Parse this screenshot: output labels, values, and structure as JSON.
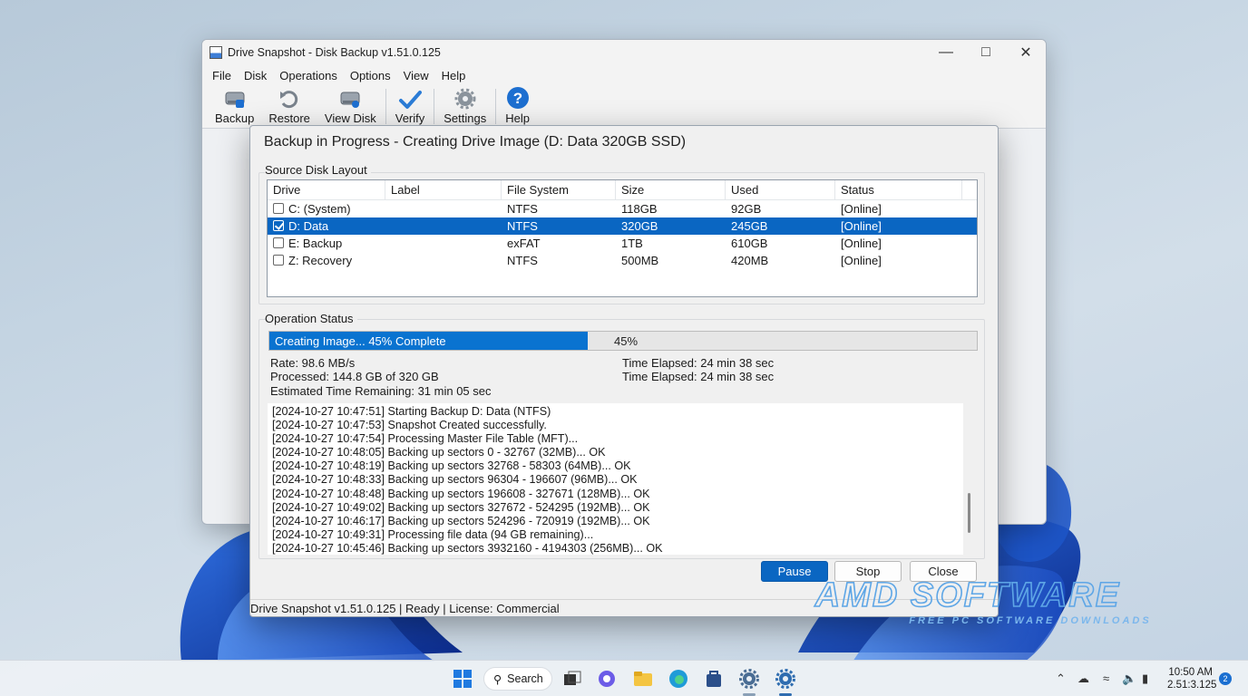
{
  "window": {
    "title": "Drive Snapshot - Disk Backup v1.51.0.125",
    "menu": [
      "File",
      "Disk",
      "Operations",
      "Options",
      "View",
      "Help"
    ],
    "toolbar": [
      {
        "label": "Backup",
        "icon": "backup-disk-icon"
      },
      {
        "label": "Restore",
        "icon": "restore-arrow-icon"
      },
      {
        "label": "View Disk",
        "icon": "view-disk-icon"
      },
      {
        "label": "Verify",
        "icon": "checkmark-icon"
      },
      {
        "label": "Settings",
        "icon": "gear-icon"
      },
      {
        "label": "Help",
        "icon": "help-question-icon"
      }
    ]
  },
  "dialog": {
    "title": "Backup in Progress - Creating Drive Image (D: Data 320GB SSD)",
    "source_group_label": "Source Disk Layout",
    "columns": [
      "Drive",
      "Label",
      "File System",
      "Size",
      "Used",
      "Status"
    ],
    "drives": [
      {
        "drive": "C: (System)",
        "label": "",
        "fs": "NTFS",
        "size": "118GB",
        "used": "92GB",
        "status": "[Online]",
        "checked": false
      },
      {
        "drive": "D: Data",
        "label": "",
        "fs": "NTFS",
        "size": "320GB",
        "used": "245GB",
        "status": "[Online]",
        "checked": true
      },
      {
        "drive": "E: Backup",
        "label": "",
        "fs": "exFAT",
        "size": "1TB",
        "used": "610GB",
        "status": "[Online]",
        "checked": false
      },
      {
        "drive": "Z: Recovery",
        "label": "",
        "fs": "NTFS",
        "size": "500MB",
        "used": "420MB",
        "status": "[Online]",
        "checked": false
      }
    ],
    "status_group_label": "Operation Status",
    "progress": {
      "text": "Creating Image... 45% Complete",
      "percent_label": "45%",
      "fraction": 0.45
    },
    "stats": {
      "rate": "Rate: 98.6 MB/s",
      "processed": "Processed: 144.8 GB of 320 GB",
      "remaining": "Estimated Time Remaining: 31 min 05 sec",
      "elapsed_1": "Time Elapsed: 24 min 38 sec",
      "elapsed_2": "Time Elapsed: 24 min 38 sec"
    },
    "log": [
      "[2024-10-27 10:47:51] Starting Backup D: Data (NTFS)",
      "[2024-10-27 10:47:53] Snapshot Created successfully.",
      "[2024-10-27 10:47:54] Processing Master File Table (MFT)...",
      "[2024-10-27 10:48:05] Backing up sectors 0 - 32767 (32MB)... OK",
      "[2024-10-27 10:48:19] Backing up sectors 32768 - 58303 (64MB)... OK",
      "[2024-10-27 10:48:33] Backing up sectors 96304 - 196607 (96MB)... OK",
      "[2024-10-27 10:48:48] Backing up sectors 196608 - 327671 (128MB)... OK",
      "[2024-10-27 10:49:02] Backing up sectors 327672 - 524295 (192MB)... OK",
      "[2024-10-27 10:46:17] Backing up sectors 524296 - 720919 (192MB)... OK",
      "[2024-10-27 10:49:31] Processing file data (94 GB remaining)...",
      "[2024-10-27 10:45:46] Backing up sectors 3932160 - 4194303 (256MB)... OK"
    ],
    "buttons": {
      "pause": "Pause",
      "stop": "Stop",
      "close": "Close"
    },
    "statusbar": "Drive Snapshot v1.51.0.125 | Ready | License: Commercial"
  },
  "watermark": {
    "title": "AMD SOFTWARE",
    "subtitle": "FREE PC SOFTWARE DOWNLOADS"
  },
  "taskbar": {
    "search_label": "Search",
    "time": "10:50 AM",
    "date": "2.51:3.125",
    "notification_count": "2"
  }
}
